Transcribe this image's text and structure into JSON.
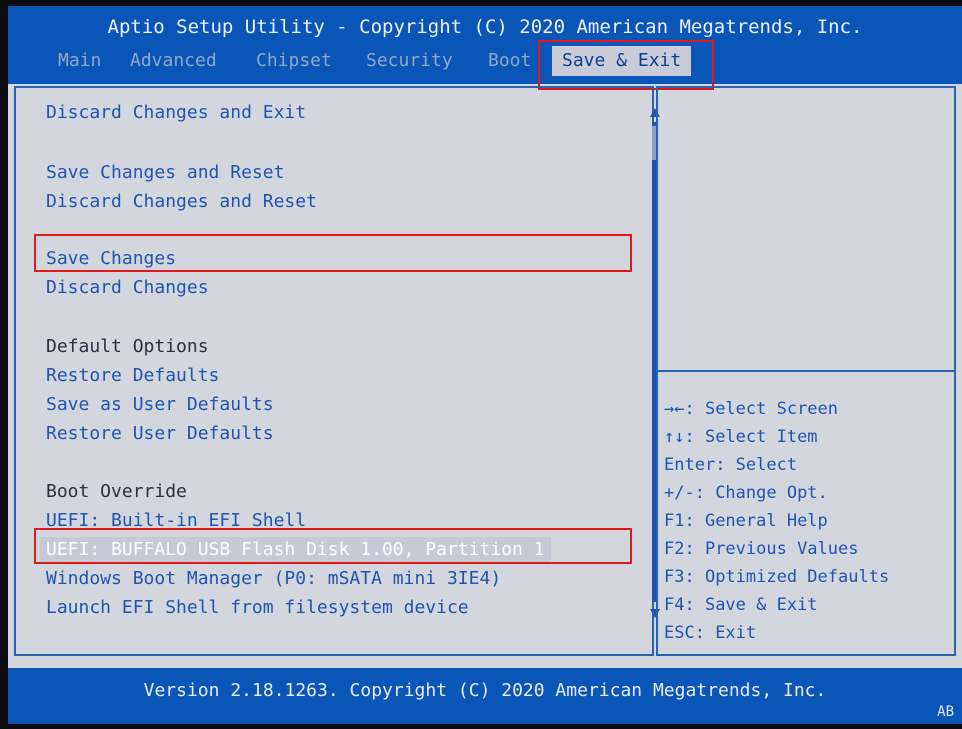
{
  "header": {
    "title": "Aptio Setup Utility - Copyright (C) 2020 American Megatrends, Inc.",
    "tabs": [
      {
        "label": "Main"
      },
      {
        "label": "Advanced"
      },
      {
        "label": "Chipset"
      },
      {
        "label": "Security"
      },
      {
        "label": "Boot"
      },
      {
        "label": "Save & Exit",
        "active": true
      }
    ]
  },
  "menu": [
    {
      "label": "Discard Changes and Exit"
    },
    {
      "label": "Save Changes and Reset"
    },
    {
      "label": "Discard Changes and Reset"
    },
    {
      "label": "Save Changes"
    },
    {
      "label": "Discard Changes"
    },
    {
      "label": "Default Options"
    },
    {
      "label": "Restore Defaults"
    },
    {
      "label": "Save as User Defaults"
    },
    {
      "label": "Restore User Defaults"
    },
    {
      "label": "Boot Override"
    },
    {
      "label": "UEFI: Built-in EFI Shell"
    },
    {
      "label": "UEFI: BUFFALO USB Flash Disk 1.00, Partition 1",
      "selected": true
    },
    {
      "label": "Windows Boot Manager (P0: mSATA mini 3IE4)"
    },
    {
      "label": "Launch EFI Shell from filesystem device"
    }
  ],
  "help": [
    {
      "key": "→←",
      "text": ": Select Screen"
    },
    {
      "key": "↑↓",
      "text": ": Select Item"
    },
    {
      "key": "Enter",
      "text": ": Select"
    },
    {
      "key": "+/-",
      "text": ": Change Opt."
    },
    {
      "key": "F1",
      "text": ": General Help"
    },
    {
      "key": "F2",
      "text": ": Previous Values"
    },
    {
      "key": "F3",
      "text": ": Optimized Defaults"
    },
    {
      "key": "F4",
      "text": ": Save & Exit"
    },
    {
      "key": "ESC",
      "text": ": Exit"
    }
  ],
  "footer": {
    "version": "Version 2.18.1263. Copyright (C) 2020 American Megatrends, Inc.",
    "badge": "AB"
  },
  "colors": {
    "header_blue": "#0a55b8",
    "link_blue": "#1f55b0",
    "highlight_red": "#e01a1a",
    "panel_bg": "#d4d6de"
  }
}
